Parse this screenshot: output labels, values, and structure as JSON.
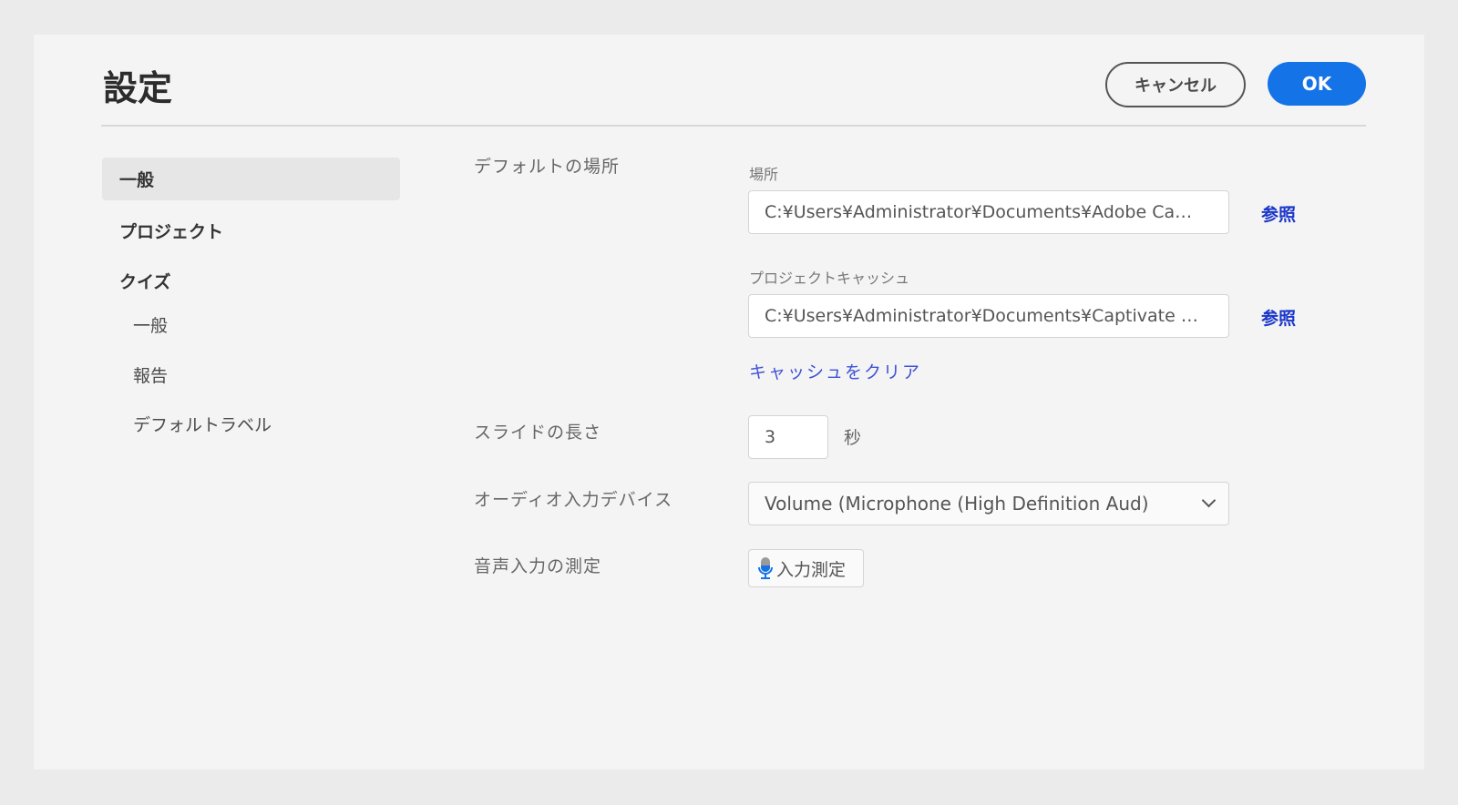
{
  "title": "設定",
  "buttons": {
    "cancel": "キャンセル",
    "ok": "OK"
  },
  "sidebar": {
    "items": [
      {
        "label": "一般"
      },
      {
        "label": "プロジェクト"
      },
      {
        "label": "クイズ"
      },
      {
        "label": "一般"
      },
      {
        "label": "報告"
      },
      {
        "label": "デフォルトラベル"
      }
    ]
  },
  "default_location": {
    "label": "デフォルトの場所",
    "location_label": "場所",
    "location_value": "C:¥Users¥Administrator¥Documents¥Adobe Ca…",
    "cache_label": "プロジェクトキャッシュ",
    "cache_value": "C:¥Users¥Administrator¥Documents¥Captivate …",
    "browse": "参照",
    "clear_cache": "キャッシュをクリア"
  },
  "slide_length": {
    "label": "スライドの長さ",
    "value": "3",
    "unit": "秒"
  },
  "audio_input": {
    "label": "オーディオ入力デバイス",
    "value": "Volume (Microphone (High Definition Aud)"
  },
  "input_measure": {
    "label": "音声入力の測定",
    "button": "入力測定"
  }
}
